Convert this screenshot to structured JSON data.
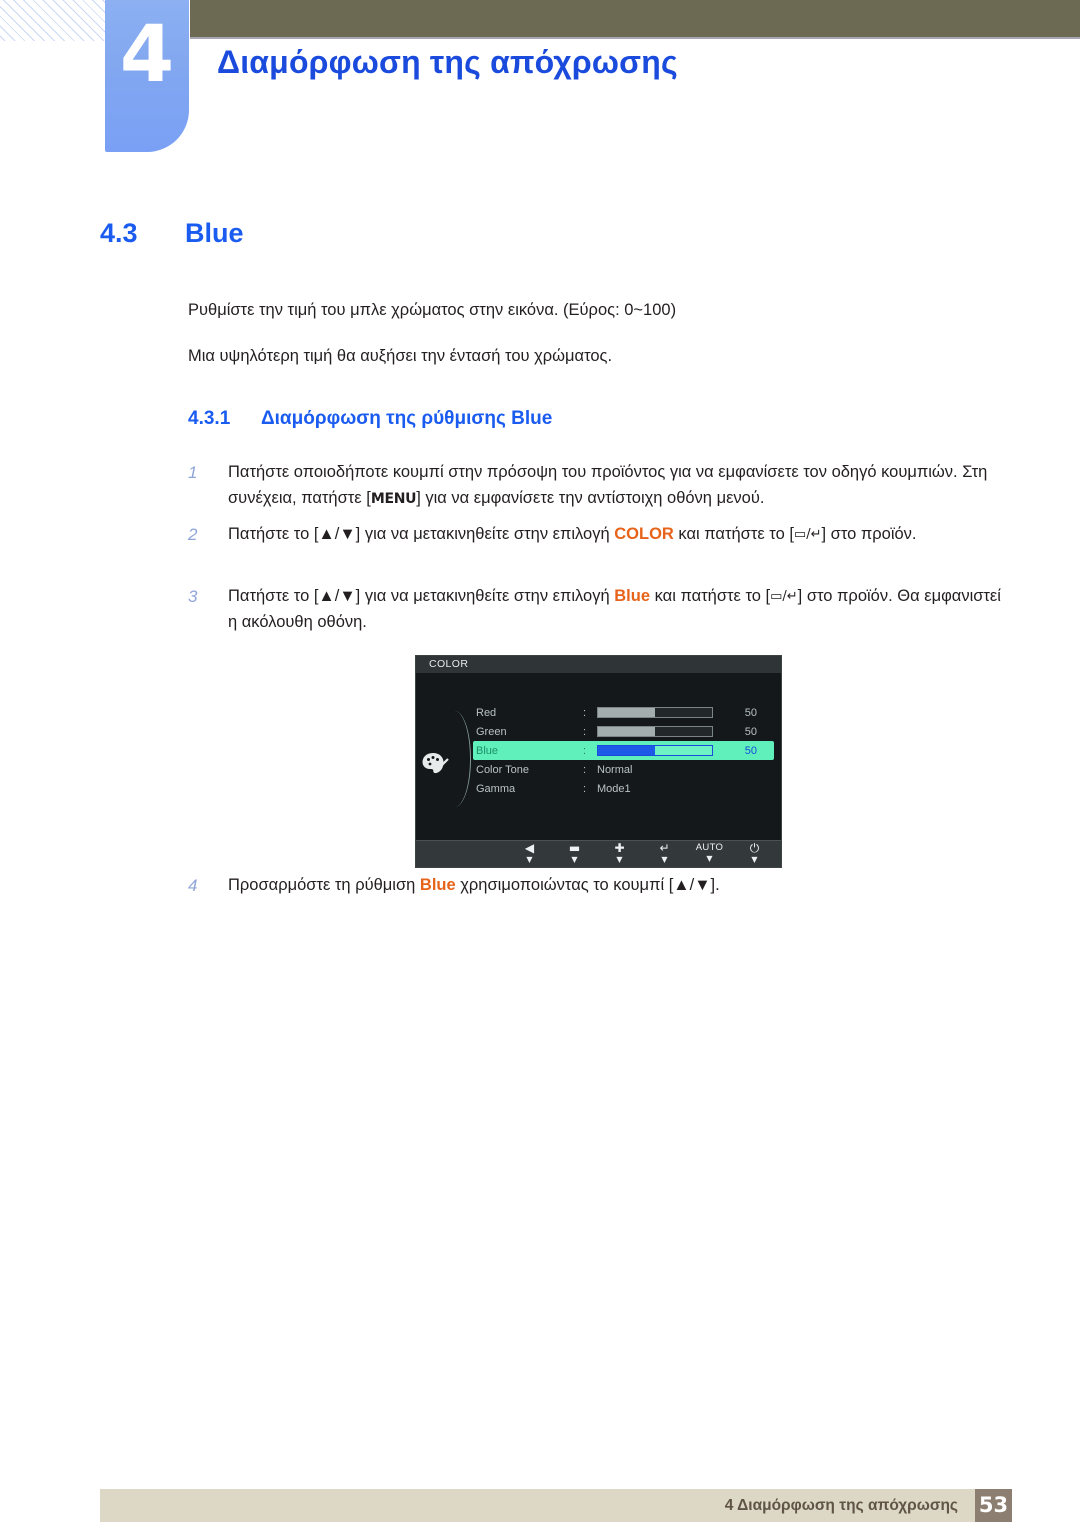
{
  "header": {
    "chapter_number": "4",
    "chapter_title": "Διαμόρφωση της απόχρωσης",
    "tab_color": "#83a8f0",
    "bar_color": "#6d6a54",
    "title_color": "#1a4bdc"
  },
  "section": {
    "number": "4.3",
    "title": "Blue",
    "intro_line_1": "Ρυθμίστε την τιμή του μπλε χρώματος στην εικόνα. (Εύρος: 0~100)",
    "intro_line_2": "Μια υψηλότερη τιμή θα αυξήσει την έντασή του χρώματος.",
    "heading_color": "#1a5bf0"
  },
  "subsection": {
    "number": "4.3.1",
    "title": "Διαμόρφωση της ρύθμισης Blue"
  },
  "steps": [
    {
      "index": "1",
      "part_a": "Πατήστε οποιοδήποτε κουμπί στην πρόσοψη του προϊόντος για να εμφανίσετε τον οδηγό κουμπιών. Στη συνέχεια, πατήστε [",
      "key": "MENU",
      "part_b": "] για να εμφανίσετε την αντίστοιχη οθόνη μενού."
    },
    {
      "index": "2",
      "part_a": "Πατήστε το [",
      "arrows": "▲/▼",
      "part_b": "] για να μετακινηθείτε στην επιλογή ",
      "keyword": "COLOR",
      "part_c": " και πατήστε το [",
      "glyphs": "▭/↵",
      "part_d": "] στο προϊόν."
    },
    {
      "index": "3",
      "part_a": "Πατήστε το [",
      "arrows": "▲/▼",
      "part_b": "] για να μετακινηθείτε στην επιλογή ",
      "keyword": "Blue",
      "part_c": " και πατήστε το [",
      "glyphs": "▭/↵",
      "part_d": "] στο προϊόν. Θα εμφανιστεί η ακόλουθη οθόνη."
    },
    {
      "index": "4",
      "part_a": "Προσαρμόστε τη ρύθμιση ",
      "keyword": "Blue",
      "part_b": " χρησιμοποιώντας το κουμπί [",
      "arrows": "▲/▼",
      "part_c": "]."
    }
  ],
  "keyword_color": "#e8631a",
  "osd": {
    "title": "COLOR",
    "icon_name": "palette-icon",
    "highlight_color": "#5ff0bb",
    "bar_fill_color": "#a3adad",
    "highlight_bar_fill_color": "#1d5ae8",
    "rows": [
      {
        "label": "Red",
        "colon": ":",
        "type": "slider",
        "value": "50",
        "percent": 50,
        "highlighted": false
      },
      {
        "label": "Green",
        "colon": ":",
        "type": "slider",
        "value": "50",
        "percent": 50,
        "highlighted": false
      },
      {
        "label": "Blue",
        "colon": ":",
        "type": "slider",
        "value": "50",
        "percent": 50,
        "highlighted": true
      },
      {
        "label": "Color Tone",
        "colon": ":",
        "type": "text",
        "value": "Normal",
        "highlighted": false
      },
      {
        "label": "Gamma",
        "colon": ":",
        "type": "text",
        "value": "Mode1",
        "highlighted": false
      }
    ],
    "buttons": [
      {
        "glyph": "◀",
        "name": "osd-back-button",
        "kind": "boxed",
        "tick": "▼"
      },
      {
        "glyph": "▬",
        "name": "osd-minus-button",
        "kind": "boxed",
        "tick": "▼"
      },
      {
        "glyph": "✚",
        "name": "osd-plus-button",
        "kind": "boxed",
        "tick": "▼"
      },
      {
        "glyph": "↵",
        "name": "osd-enter-button",
        "kind": "boxed",
        "tick": "▼"
      },
      {
        "glyph": "AUTO",
        "name": "osd-auto-button",
        "kind": "text",
        "tick": "▼"
      },
      {
        "glyph": "⏻",
        "name": "osd-power-button",
        "kind": "plain",
        "tick": "▼"
      }
    ]
  },
  "footer": {
    "text": "4 Διαμόρφωση της απόχρωσης",
    "page": "53",
    "bar_color": "#ddd7c5",
    "page_box_color": "#8c7f72"
  }
}
